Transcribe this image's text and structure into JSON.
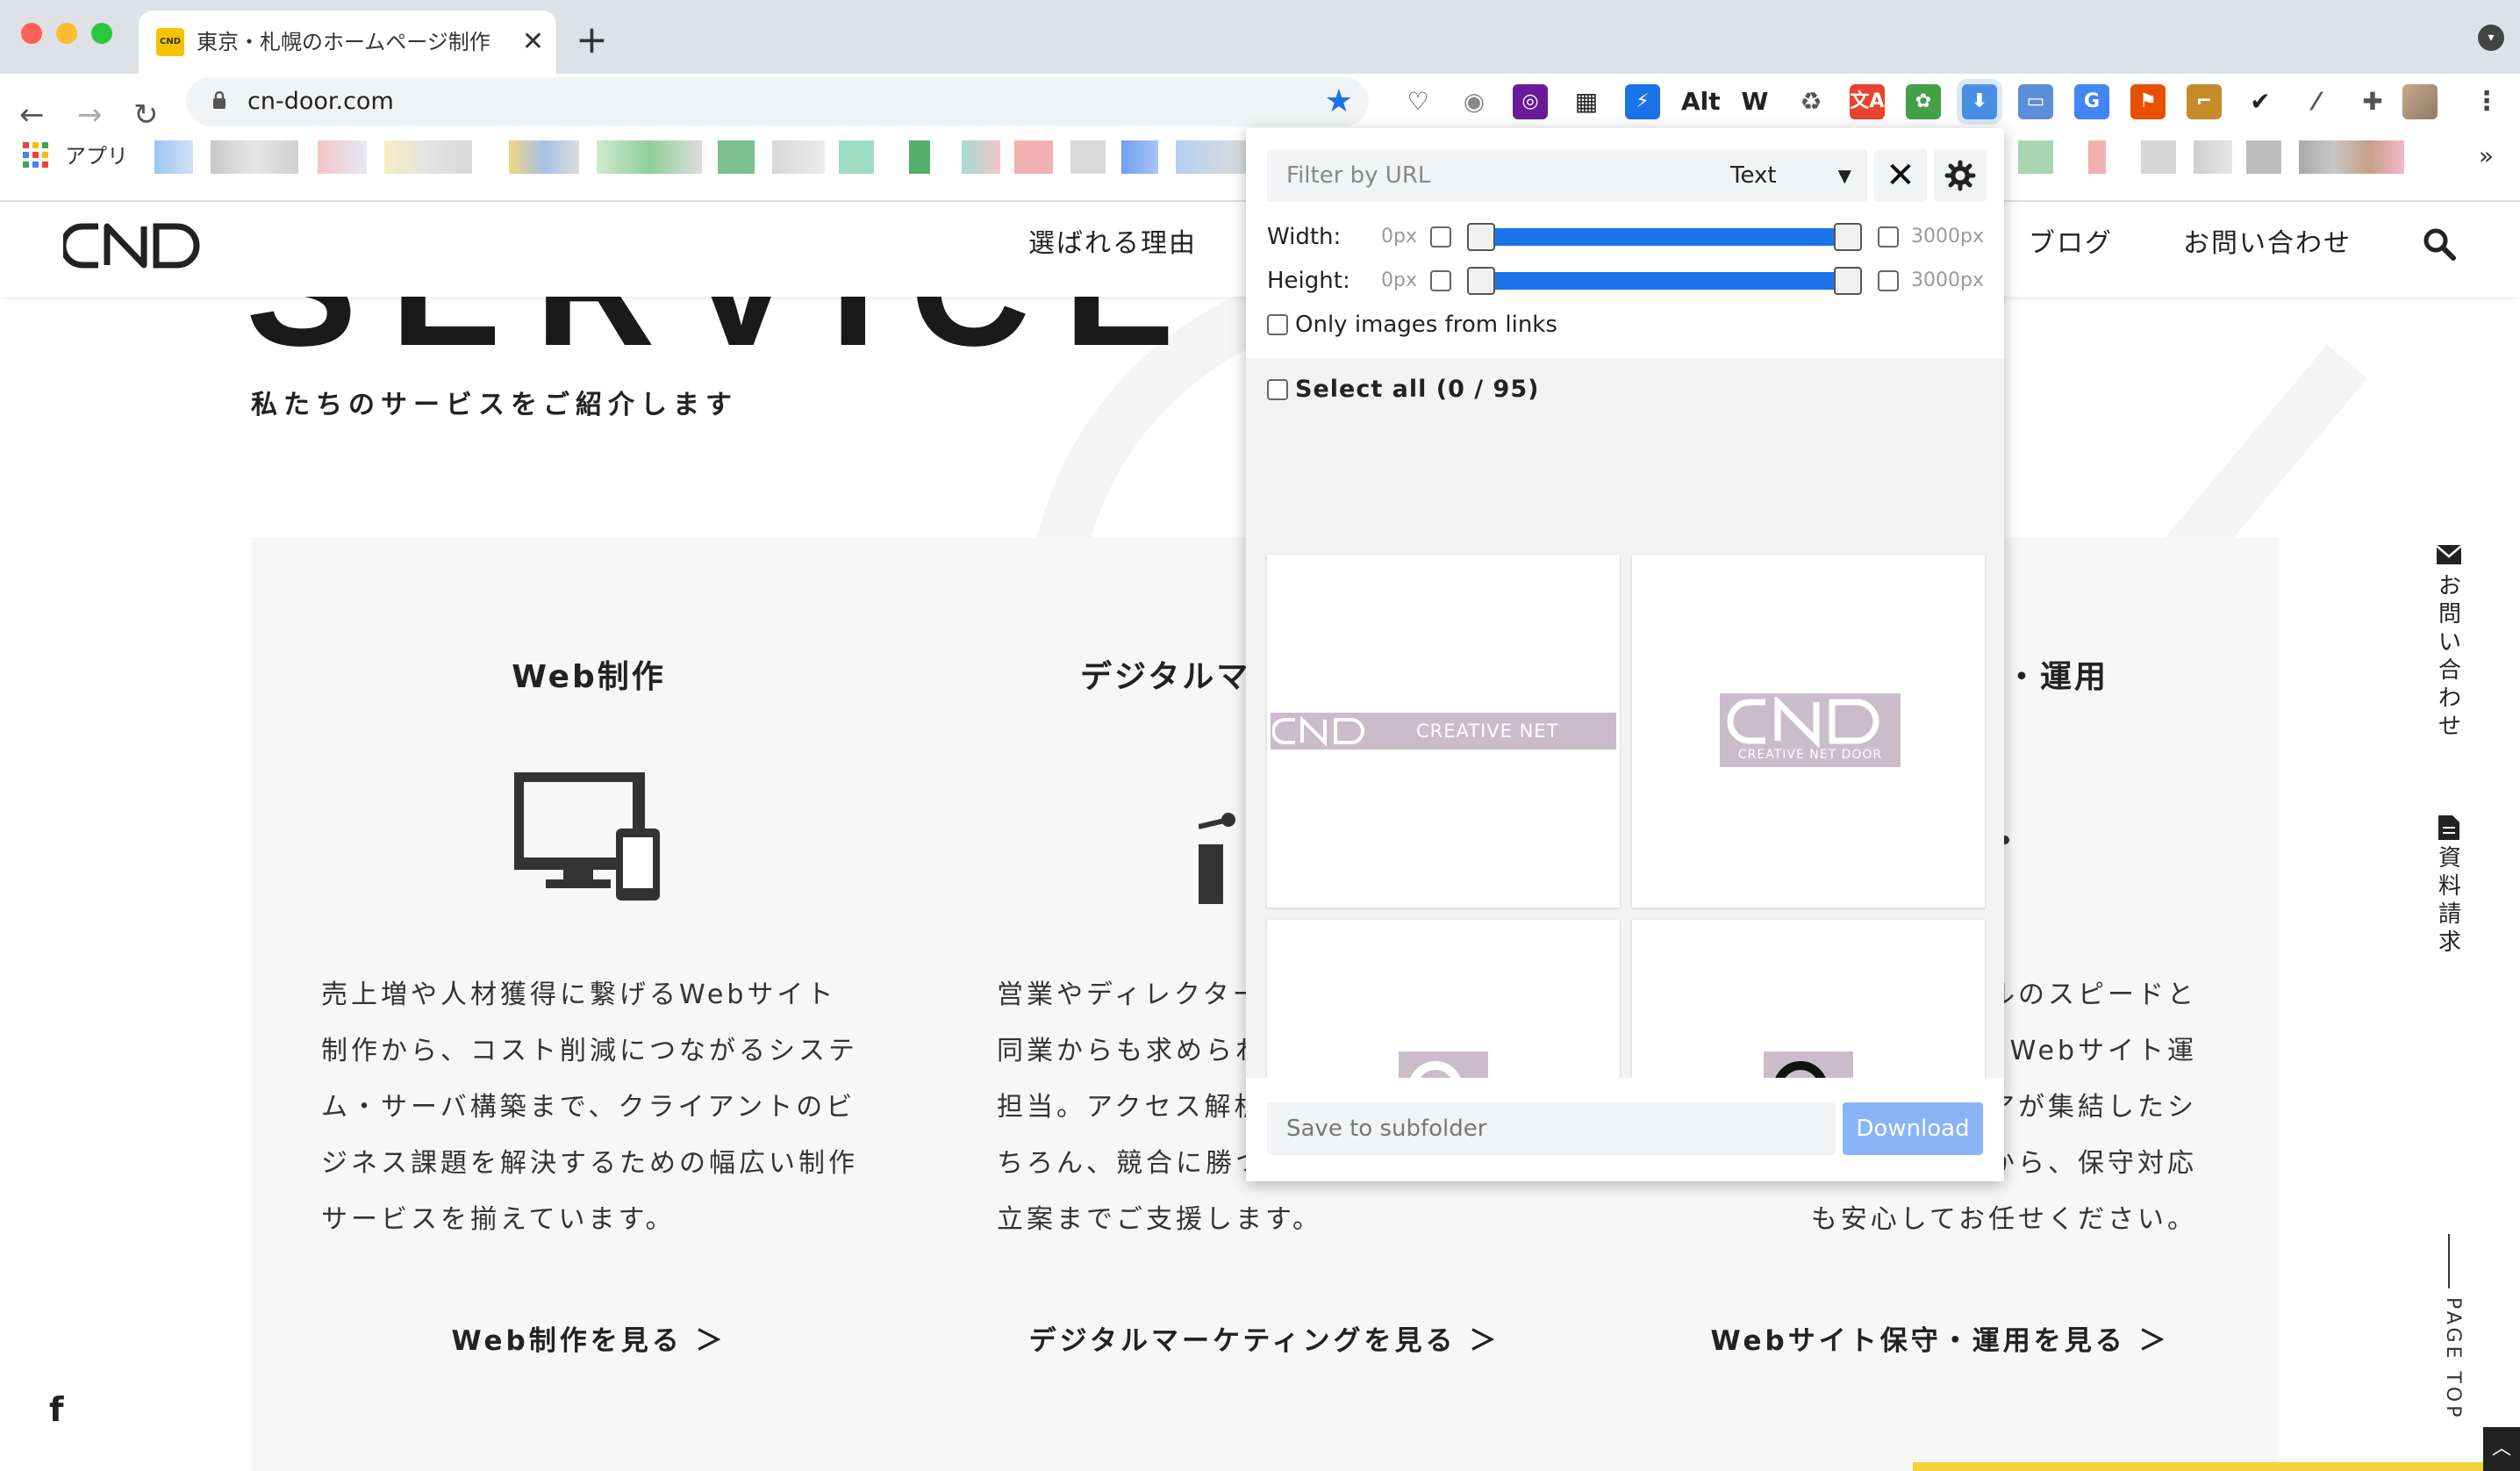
{
  "browser": {
    "tab_title": "東京・札幌のホームページ制作",
    "tab_favicon": "CND",
    "tab_close": "✕",
    "new_tab": "+",
    "url": "cn-door.com",
    "bookmarks_label": "アプリ",
    "bookmarks_more": "»",
    "extensions": [
      {
        "icon": "pocket-icon",
        "color": "#333333",
        "glyph": "♡"
      },
      {
        "icon": "camera-icon",
        "color": "#888888",
        "glyph": "◉"
      },
      {
        "icon": "color-picker-icon",
        "color": "#6a1b9a",
        "glyph": "◎"
      },
      {
        "icon": "qr-code-icon",
        "color": "#222222",
        "glyph": "▦"
      },
      {
        "icon": "lightning-icon",
        "color": "#1a73e8",
        "glyph": "⚡"
      },
      {
        "icon": "alt-text-icon",
        "color": "#222222",
        "glyph": "Alt"
      },
      {
        "icon": "w-icon",
        "color": "#222222",
        "glyph": "W"
      },
      {
        "icon": "recycle-icon",
        "color": "#555555",
        "glyph": "♻"
      },
      {
        "icon": "translate-red-icon",
        "color": "#e8432e",
        "glyph": "文A"
      },
      {
        "icon": "puzzle-green-icon",
        "color": "#43a047",
        "glyph": "✿"
      },
      {
        "icon": "image-downloader-icon",
        "color": "#4a90e2",
        "glyph": "⬇"
      },
      {
        "icon": "window-icon",
        "color": "#5b8fd8",
        "glyph": "▭"
      },
      {
        "icon": "google-translate-icon",
        "color": "#4285f4",
        "glyph": "G"
      },
      {
        "icon": "flag-icon",
        "color": "#e65100",
        "glyph": "⚑"
      },
      {
        "icon": "ruler-icon",
        "color": "#c68a2a",
        "glyph": "⌐"
      },
      {
        "icon": "checkbox-icon",
        "color": "#222222",
        "glyph": "✔"
      },
      {
        "icon": "eyedropper-icon",
        "color": "#555555",
        "glyph": "⁄"
      },
      {
        "icon": "extensions-puzzle-icon",
        "color": "#555555",
        "glyph": "✚"
      }
    ]
  },
  "site": {
    "nav": [
      "選ばれる理由",
      "ブログ",
      "お問い合わせ"
    ],
    "hero_word": "SERVICE",
    "hero_sub": "私たちのサービスをご紹介します",
    "cards": [
      {
        "title": "Web制作",
        "text": "売上増や人材獲得に繋げるWebサイト制作から、コスト削減につながるシステム・サーバ構築まで、クライアントのビジネス課題を解決するための幅広い制作サービスを揃えています。",
        "link": "Web制作を見る ＞"
      },
      {
        "title": "デジタルマ",
        "text": "営業やディレクター\n同業からも求められ\n担当。アクセス解析\nちろん、競合に勝つ\n立案までご支援します。",
        "link": "デジタルマーケティングを見る ＞"
      },
      {
        "title": "・運用",
        "text": "ルのスピードと\nのWebサイト運\nアが集結したシ\nから、保守対応\nも安心してお任せください。",
        "link": "Webサイト保守・運用を見る ＞"
      }
    ],
    "side_contact": "お問い合わせ",
    "side_docs": "資料請求",
    "page_top": "PAGE TOP",
    "facebook": "f"
  },
  "popup": {
    "filter_placeholder": "Filter by URL",
    "type_select": "Text",
    "width_label": "Width:",
    "height_label": "Height:",
    "min_value": "0px",
    "max_value": "3000px",
    "only_links_label": "Only images from links",
    "select_all_label": "Select all (0 / 95)",
    "tile_caption_1": "CREATIVE NET DOOR",
    "tile_caption_2": "CREATIVE NET DOOR",
    "subfolder_placeholder": "Save to subfolder",
    "download_label": "Download"
  }
}
